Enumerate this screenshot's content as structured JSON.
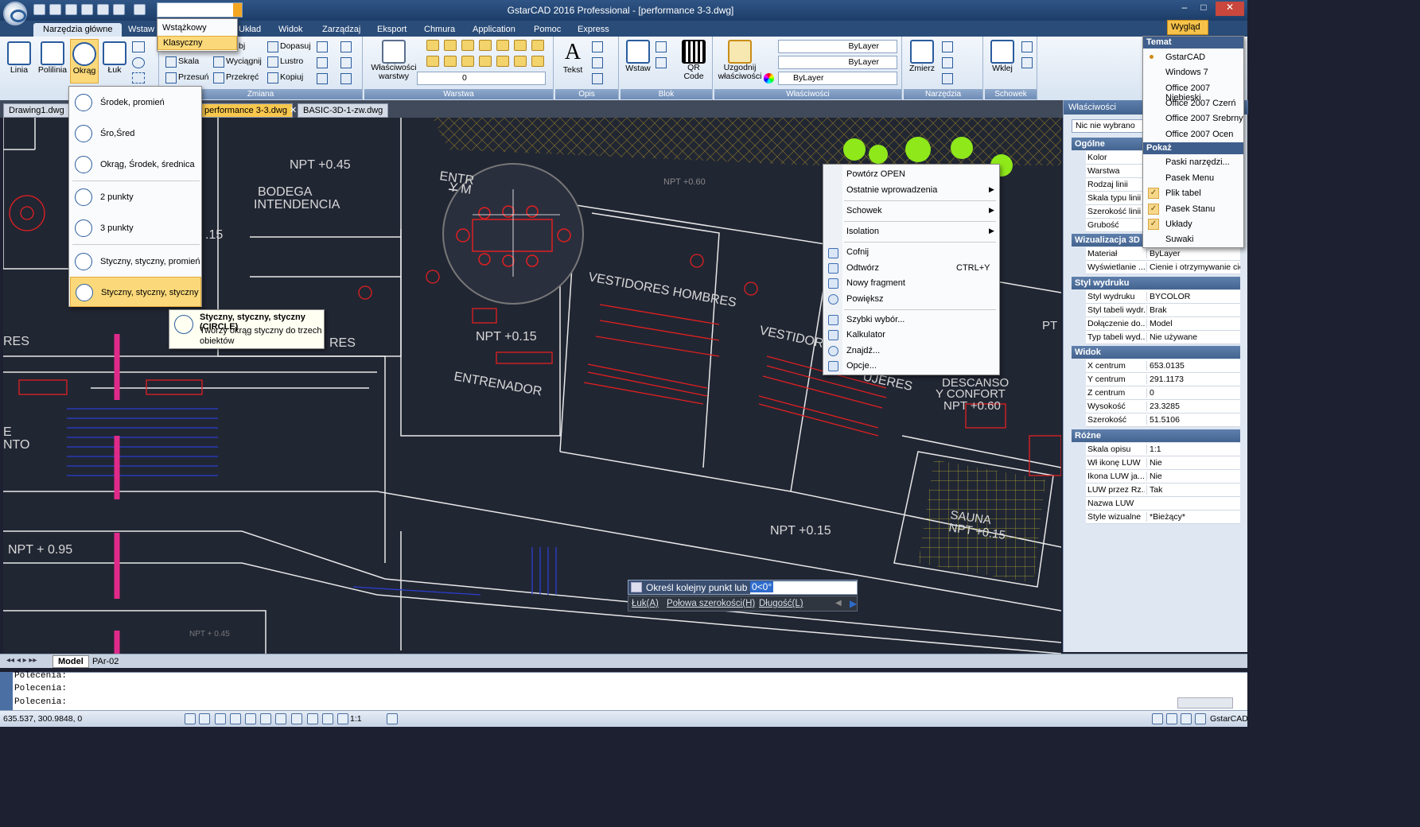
{
  "title_bar": {
    "workspace": "Wstążkowy",
    "title": "GstarCAD 2016 Professional - [performance 3-3.dwg]",
    "minimize": "–",
    "maximize": "□",
    "close": "✕"
  },
  "menu_tabs": [
    "Narzędzia główne",
    "Wstaw",
    "Układ",
    "Widok",
    "Zarządzaj",
    "Eksport",
    "Chmura",
    "Application",
    "Pomoc",
    "Express"
  ],
  "wyglad": "Wygląd",
  "workspace_menu": [
    "Wstążkowy",
    "Klasyczny"
  ],
  "ribbon": {
    "rysuj": {
      "linia": "Linia",
      "polilinia": "Polilinia",
      "okrag": "Okrąg",
      "luk": "Łuk"
    },
    "zmiana": {
      "label": "Zmiana",
      "items": [
        "Skala",
        "Przesuń",
        "Wyciągnij",
        "Przekręć",
        "Lustro",
        "Kopiuj",
        "Dopasuj"
      ],
      "obj": "bj"
    },
    "warstwa": {
      "label": "Warstwa",
      "wlasciwosci": "Właściwości warstwy",
      "layer_value": "0"
    },
    "opis": {
      "label": "Opis",
      "tekst": "Tekst"
    },
    "blok": {
      "label": "Blok",
      "wstaw": "Wstaw",
      "qr": "QR Code"
    },
    "wlasciwosci": {
      "label": "Właściwości",
      "uzgodnij": "Uzgodnij właściwości",
      "bylayer": "ByLayer"
    },
    "narzedzia": {
      "label": "Narzędzia",
      "zmierz": "Zmierz"
    },
    "schowek": {
      "label": "Schowek",
      "wklej": "Wklej"
    }
  },
  "doc_tabs": [
    "Drawing1.dwg",
    "performance 3-3.dwg",
    "BASIC-3D-1-zw.dwg"
  ],
  "okrag_menu": [
    "Środek, promień",
    "Śro,Śred",
    "Okrąg, Środek, średnica",
    "2 punkty",
    "3 punkty",
    "Styczny, styczny, promień",
    "Styczny, styczny, styczny"
  ],
  "tooltip": {
    "title": "Styczny, styczny, styczny (CIRCLE)",
    "desc": "Tworzy okrąg styczny do trzech obiektów"
  },
  "context_menu": {
    "powtorz": "Powtórz OPEN",
    "ostatnie": "Ostatnie wprowadzenia",
    "schowek": "Schowek",
    "isolation": "Isolation",
    "cofnij": "Cofnij",
    "odtworz": "Odtwórz",
    "odtworz_key": "CTRL+Y",
    "nowy": "Nowy fragment",
    "powieksz": "Powiększ",
    "szybki": "Szybki wybór...",
    "kalkulator": "Kalkulator",
    "znajdz": "Znajdź...",
    "opcje": "Opcje..."
  },
  "theme_menu": {
    "temat": "Temat",
    "themes": [
      "GstarCAD",
      "Windows 7",
      "Office 2007 Niebieski",
      "Office 2007 Czerń",
      "Office 2007 Srebrny",
      "Office 2007 Ocen"
    ],
    "pokaz": "Pokaż",
    "show": [
      "Paski narzędzi...",
      "Pasek Menu",
      "Plik tabel",
      "Pasek Stanu",
      "Układy",
      "Suwaki"
    ]
  },
  "properties": {
    "title": "Właściwości",
    "selection": "Nic nie wybrano",
    "ogolne": {
      "label": "Ogólne",
      "rows": [
        [
          "Kolor",
          ""
        ],
        [
          "Warstwa",
          ""
        ],
        [
          "Rodzaj linii",
          ""
        ],
        [
          "Skala typu linii",
          ""
        ],
        [
          "Szerokość linii",
          ""
        ],
        [
          "Grubość",
          ""
        ]
      ]
    },
    "wiz": {
      "label": "Wizualizacja 3D",
      "rows": [
        [
          "Materiał",
          "ByLayer"
        ],
        [
          "Wyświetlanie ...",
          "Cienie i otrzymywanie cieni"
        ]
      ]
    },
    "styl": {
      "label": "Styl wydruku",
      "rows": [
        [
          "Styl wydruku",
          "BYCOLOR"
        ],
        [
          "Styl tabeli wydr...",
          "Brak"
        ],
        [
          "Dołączenie do...",
          "Model"
        ],
        [
          "Typ tabeli wyd...",
          "Nie używane"
        ]
      ]
    },
    "widok": {
      "label": "Widok",
      "rows": [
        [
          "X centrum",
          "653.0135"
        ],
        [
          "Y centrum",
          "291.1173"
        ],
        [
          "Z centrum",
          "0"
        ],
        [
          "Wysokość",
          "23.3285"
        ],
        [
          "Szerokość",
          "51.5106"
        ]
      ]
    },
    "rozne": {
      "label": "Różne",
      "rows": [
        [
          "Skala opisu",
          "1:1"
        ],
        [
          "Wł ikonę LUW",
          "Nie"
        ],
        [
          "Ikona LUW ja...",
          "Nie"
        ],
        [
          "LUW przez Rz...",
          "Tak"
        ],
        [
          "Nazwa LUW",
          ""
        ],
        [
          "Style wizualne",
          "*Bieżący*"
        ]
      ]
    }
  },
  "cad_labels": {
    "npt045": "NPT +0.45",
    "bodega": "BODEGA",
    "intendencia": "INTENDENCIA",
    "entr": "ENTR",
    "ym": "Y M",
    "npt015a": "NPT +0.15",
    "entrenador": "ENTRENADOR",
    "vest_h": "VESTIDORES HOMBRES",
    "vestidor": "VESTIDOR",
    "mujeres": "UJERES",
    "descanso": "DESCANSO",
    "confort": "Y CONFORT",
    "npt060": "NPT +0.60",
    "npt060b": "NPT +0.60",
    "sauna": "SAUNA",
    "npt015s": "NPT +0.15",
    "npt015b": "NPT +0.15",
    "npt095": "NPT + 0.95",
    "npt045b": "NPT + 0.45",
    "res1": "RES",
    "res2": "RES",
    "e": "E",
    "nto": "NTO",
    "num15": ".15",
    "pt": "PT"
  },
  "dynamic_input": {
    "prompt": "Określ kolejny punkt lub",
    "value": "0<0°",
    "opts": [
      "Łuk(A)",
      "Połowa szerokości(H)",
      "Długość(L)"
    ]
  },
  "layout_tabs": [
    "Model",
    "PAr-02"
  ],
  "command_lines": [
    "Polecenia:",
    "Polecenia:",
    "Polecenia:"
  ],
  "status": {
    "coords": "635.537, 300.9848, 0",
    "scale": "1:1",
    "app": "GstarCAD"
  },
  "colors": {
    "accent": "#f7c74e",
    "canvas": "#212633",
    "ribbon_blue": "#2a4c79"
  }
}
